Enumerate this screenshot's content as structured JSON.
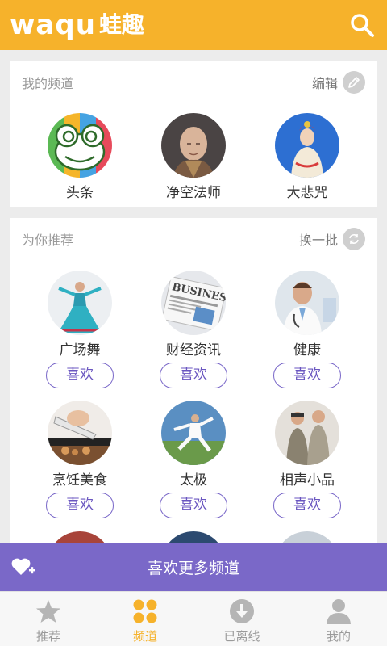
{
  "header": {
    "logo_latin": "waqu",
    "logo_cn": "蛙趣",
    "background": "#f6b22b"
  },
  "my_channels": {
    "title": "我的频道",
    "edit_label": "编辑",
    "items": [
      {
        "label": "头条",
        "icon": "frog-logo"
      },
      {
        "label": "净空法师",
        "icon": "monk-portrait"
      },
      {
        "label": "大悲咒",
        "icon": "bodhisattva-image"
      }
    ]
  },
  "recommend": {
    "title": "为你推荐",
    "refresh_label": "换一批",
    "like_label": "喜欢",
    "items": [
      {
        "label": "广场舞",
        "icon": "dancer-photo"
      },
      {
        "label": "财经资讯",
        "icon": "business-newspaper"
      },
      {
        "label": "健康",
        "icon": "doctor-photo"
      },
      {
        "label": "烹饪美食",
        "icon": "cooking-photo"
      },
      {
        "label": "太极",
        "icon": "taichi-photo"
      },
      {
        "label": "相声小品",
        "icon": "crosstalk-photo"
      }
    ]
  },
  "more_bar": {
    "label": "喜欢更多频道",
    "background": "#7a68c8"
  },
  "bottom_nav": {
    "items": [
      {
        "label": "推荐",
        "icon": "star-icon"
      },
      {
        "label": "频道",
        "icon": "grid-dots-icon",
        "active": true
      },
      {
        "label": "已离线",
        "icon": "download-icon"
      },
      {
        "label": "我的",
        "icon": "person-icon"
      }
    ],
    "active_color": "#f6b22b"
  }
}
